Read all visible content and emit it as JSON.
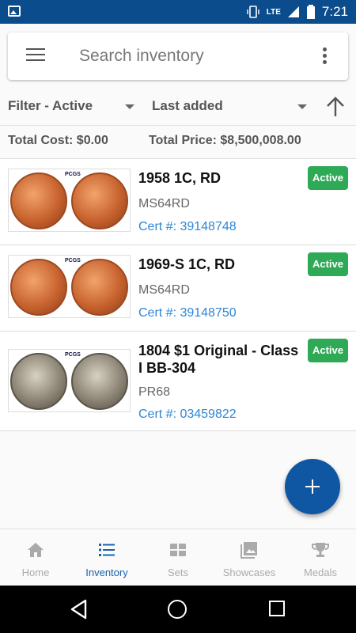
{
  "status_bar": {
    "network": "LTE",
    "time": "7:21"
  },
  "search": {
    "placeholder": "Search inventory"
  },
  "filter": {
    "label": "Filter - Active",
    "sort_label": "Last added",
    "sort_direction": "ascending"
  },
  "totals": {
    "cost": "Total Cost: $0.00",
    "price": "Total Price: $8,500,008.00"
  },
  "items": [
    {
      "title": "1958 1C, RD",
      "grade": "MS64RD",
      "cert": "Cert #: 39148748",
      "status": "Active",
      "metal": "copper"
    },
    {
      "title": "1969-S 1C, RD",
      "grade": "MS64RD",
      "cert": "Cert #: 39148750",
      "status": "Active",
      "metal": "copper"
    },
    {
      "title": "1804 $1 Original - Class I BB-304",
      "grade": "PR68",
      "cert": "Cert #: 03459822",
      "status": "Active",
      "metal": "silver"
    }
  ],
  "pcgs_label": "PCGS",
  "bottom_nav": [
    {
      "label": "Home",
      "icon": "home-icon",
      "active": false
    },
    {
      "label": "Inventory",
      "icon": "list-icon",
      "active": true
    },
    {
      "label": "Sets",
      "icon": "grid-icon",
      "active": false
    },
    {
      "label": "Showcases",
      "icon": "image-icon",
      "active": false
    },
    {
      "label": "Medals",
      "icon": "trophy-icon",
      "active": false
    }
  ],
  "colors": {
    "primary": "#0f57a3",
    "status_bar": "#0b4c8c",
    "badge": "#2eaa57",
    "link": "#2f86d6",
    "active_nav": "#1761ad"
  }
}
